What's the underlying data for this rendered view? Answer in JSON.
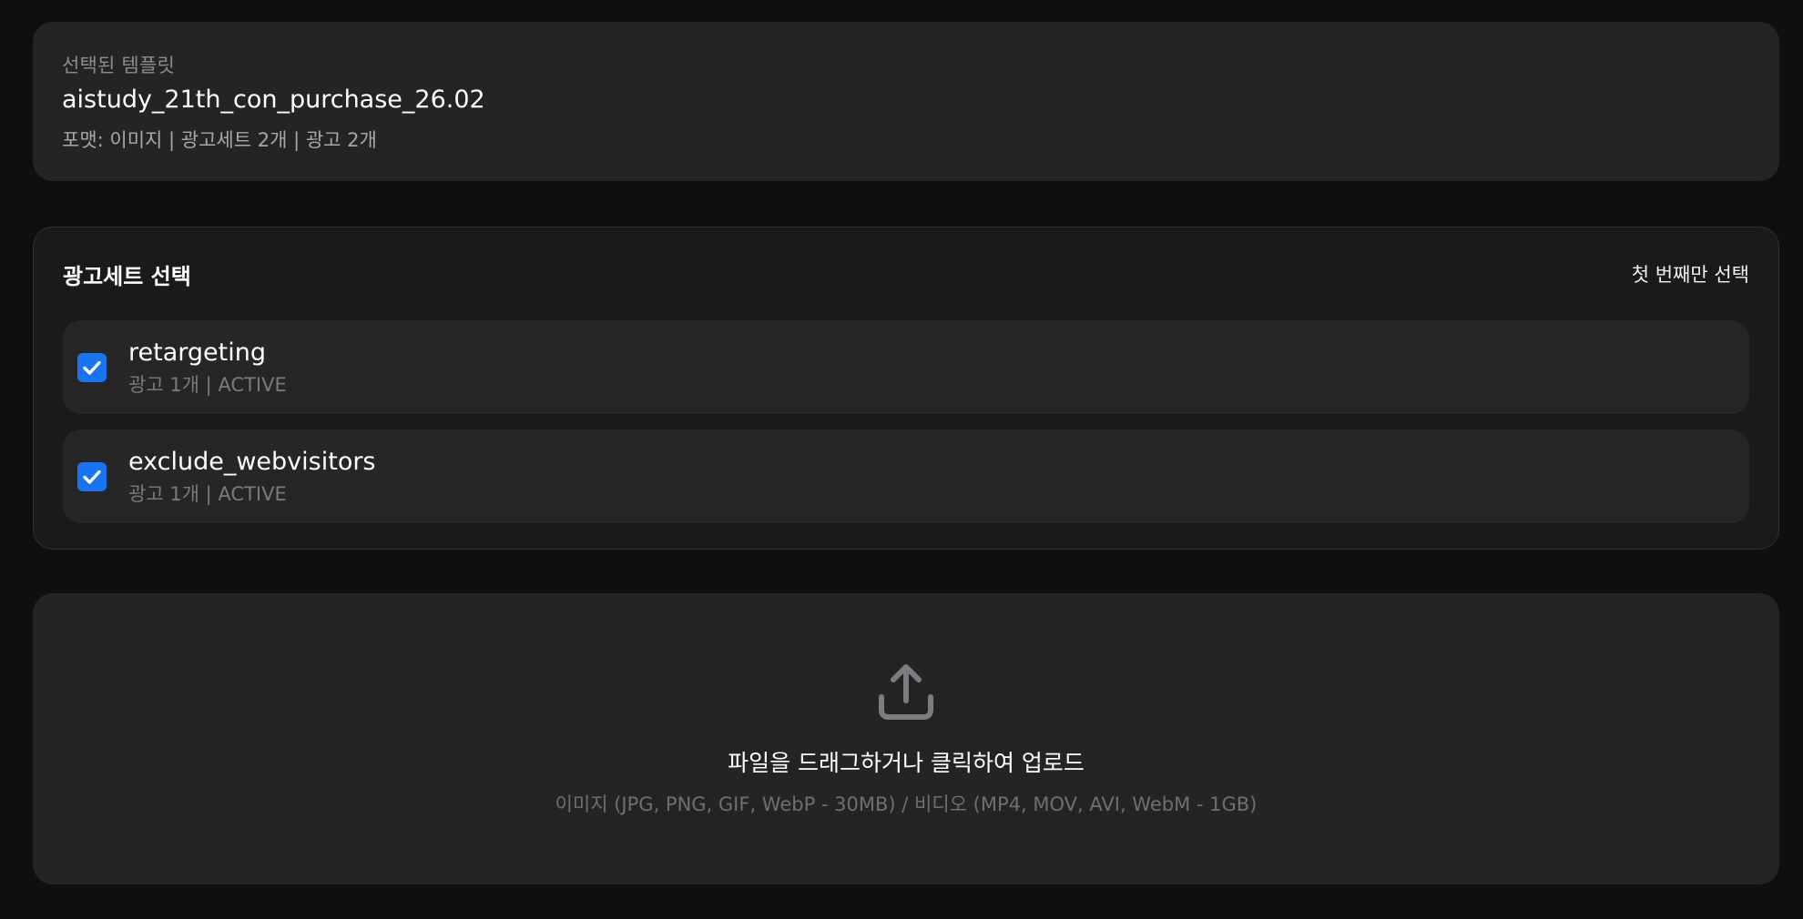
{
  "template": {
    "eyebrow": "선택된 템플릿",
    "name": "aistudy_21th_con_purchase_26.02",
    "meta": "포맷: 이미지 | 광고세트 2개 | 광고 2개"
  },
  "adsets": {
    "title": "광고세트 선택",
    "select_first_label": "첫 번째만 선택",
    "items": [
      {
        "name": "retargeting",
        "meta": "광고 1개 | ACTIVE",
        "checked": true
      },
      {
        "name": "exclude_webvisitors",
        "meta": "광고 1개 | ACTIVE",
        "checked": true
      }
    ]
  },
  "upload": {
    "icon": "upload-icon",
    "title": "파일을 드래그하거나 클릭하여 업로드",
    "hint": "이미지 (JPG, PNG, GIF, WebP - 30MB) / 비디오 (MP4, MOV, AVI, WebM - 1GB)"
  },
  "colors": {
    "background": "#0f0f0f",
    "card": "#242424",
    "checkbox_accent": "#1a73f0",
    "muted_text": "#7a7a7a"
  }
}
